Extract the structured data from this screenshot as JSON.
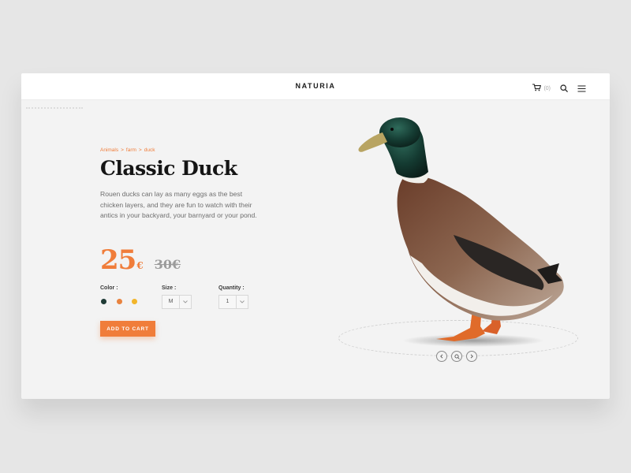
{
  "header": {
    "brand": "NATURIA",
    "cart_icon": "cart-icon",
    "cart_count": "(0)",
    "search_icon": "search-icon",
    "menu_icon": "menu-icon"
  },
  "breadcrumb": [
    "Animals",
    "farm",
    "duck"
  ],
  "breadcrumb_separator": ">",
  "product": {
    "title": "Classic Duck",
    "description": "Rouen ducks can lay as many eggs as the best chicken layers, and they are fun to watch with their antics in your backyard, your barnyard or your pond.",
    "price_current": "25",
    "price_currency": "€",
    "price_old": "30€"
  },
  "options": {
    "color_label": "Color :",
    "colors": [
      "#1f3b36",
      "#e8833f",
      "#f2b52a"
    ],
    "size_label": "Size :",
    "size_value": "M",
    "quantity_label": "Quantity :",
    "quantity_value": "1"
  },
  "actions": {
    "add_to_cart": "ADD TO CART"
  },
  "gallery_controls": {
    "prev_icon": "chevron-left-icon",
    "zoom_icon": "search-icon",
    "next_icon": "chevron-right-icon"
  },
  "colors": {
    "accent": "#f07d3a",
    "text_dark": "#151515",
    "text_muted": "#6e6e6e",
    "background": "#e6e6e6",
    "card": "#f3f3f3"
  }
}
